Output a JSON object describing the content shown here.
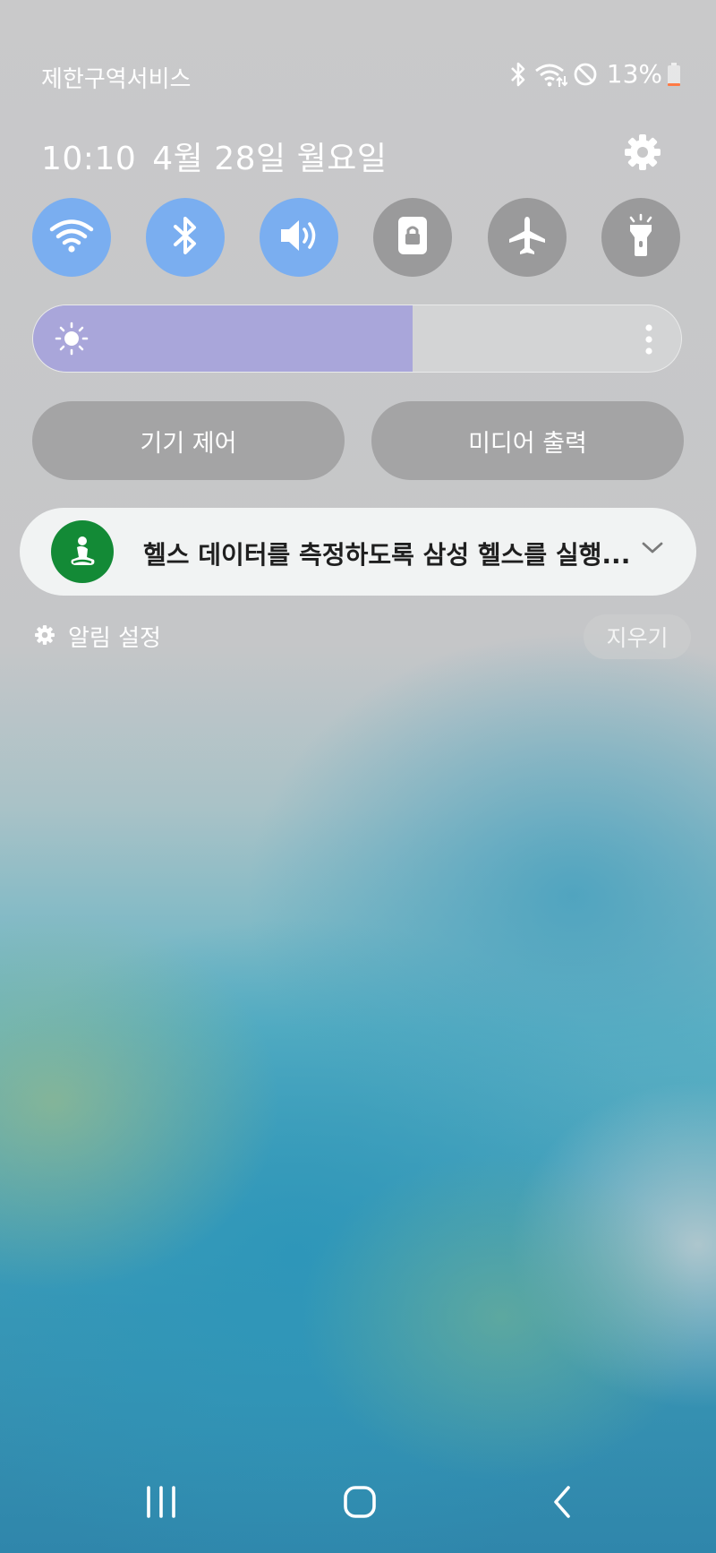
{
  "status_bar": {
    "carrier": "제한구역서비스",
    "icons": [
      "bluetooth-icon",
      "wifi-data-icon",
      "do-not-disturb-icon",
      "battery-icon"
    ],
    "battery_percent": "13%",
    "battery_level": 0.13,
    "battery_color": "#ff7a45"
  },
  "header": {
    "time": "10:10",
    "date": "4월 28일 월요일",
    "settings_icon": "gear-icon"
  },
  "quick_toggles": [
    {
      "name": "wifi",
      "icon": "wifi-icon",
      "state": "on"
    },
    {
      "name": "bluetooth",
      "icon": "bluetooth-icon",
      "state": "on"
    },
    {
      "name": "sound",
      "icon": "volume-icon",
      "state": "on"
    },
    {
      "name": "screen-lock",
      "icon": "lock-rotation-icon",
      "state": "off"
    },
    {
      "name": "airplane",
      "icon": "airplane-icon",
      "state": "off"
    },
    {
      "name": "flashlight",
      "icon": "flashlight-icon",
      "state": "off"
    }
  ],
  "colors": {
    "toggle_on": "#7aaef0",
    "toggle_off": "#9a9a9b",
    "brightness_fill": "#a9a6da",
    "app_icon_bg": "#138a36"
  },
  "brightness": {
    "level": 0.586,
    "icon": "sun-icon",
    "more_icon": "more-vertical-icon"
  },
  "buttons": {
    "device_control": "기기 제어",
    "media_output": "미디어 출력"
  },
  "notification": {
    "app_icon": "samsung-health-icon",
    "text": "헬스 데이터를 측정하도록 삼성 헬스를 실행...",
    "expand_icon": "chevron-down-icon"
  },
  "notification_footer": {
    "settings_label": "알림 설정",
    "clear_label": "지우기"
  },
  "navbar": {
    "recents_icon": "recents-icon",
    "home_icon": "home-icon",
    "back_icon": "back-icon"
  }
}
